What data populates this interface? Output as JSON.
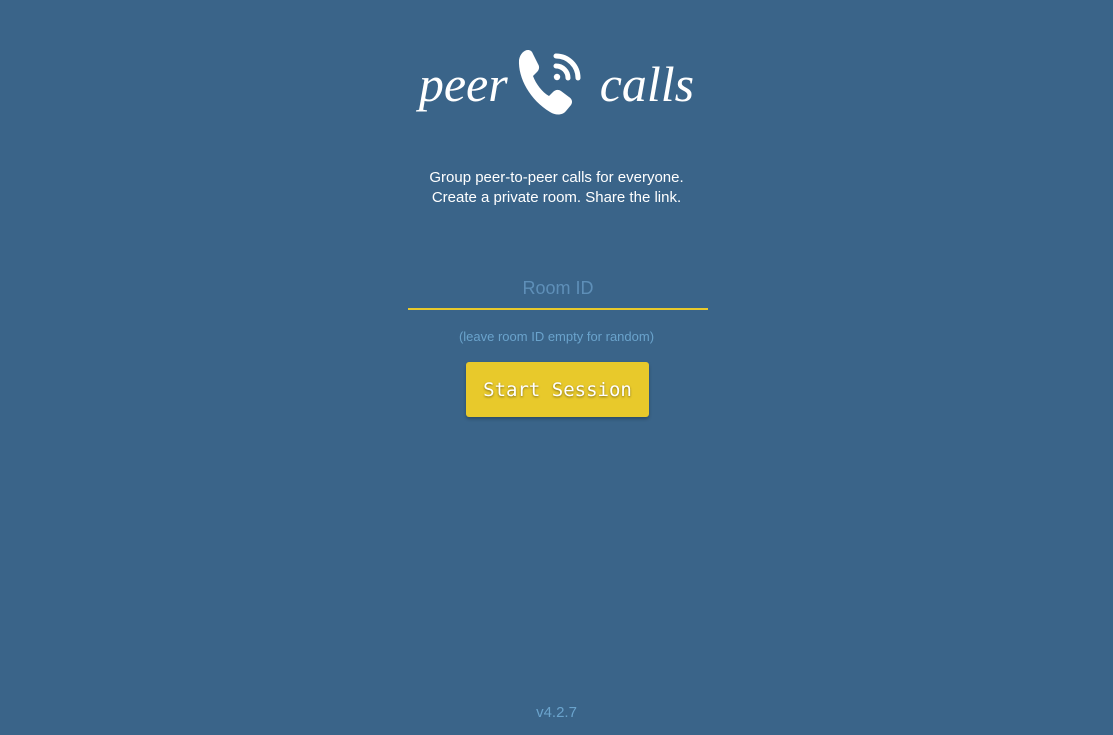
{
  "logo": {
    "word_left": "peer",
    "word_right": "calls",
    "icon": "phone-with-signal-icon"
  },
  "tagline": {
    "line1": "Group peer-to-peer calls for everyone.",
    "line2": "Create a private room. Share the link."
  },
  "room_input": {
    "placeholder": "Room ID",
    "value": ""
  },
  "hint": "(leave room ID empty for random)",
  "start_button": {
    "label": "Start Session"
  },
  "footer": {
    "version": "v4.2.7"
  },
  "colors": {
    "background": "#3a6489",
    "accent": "#e8c92b",
    "muted_text": "#6aa3cc",
    "text": "#ffffff"
  }
}
